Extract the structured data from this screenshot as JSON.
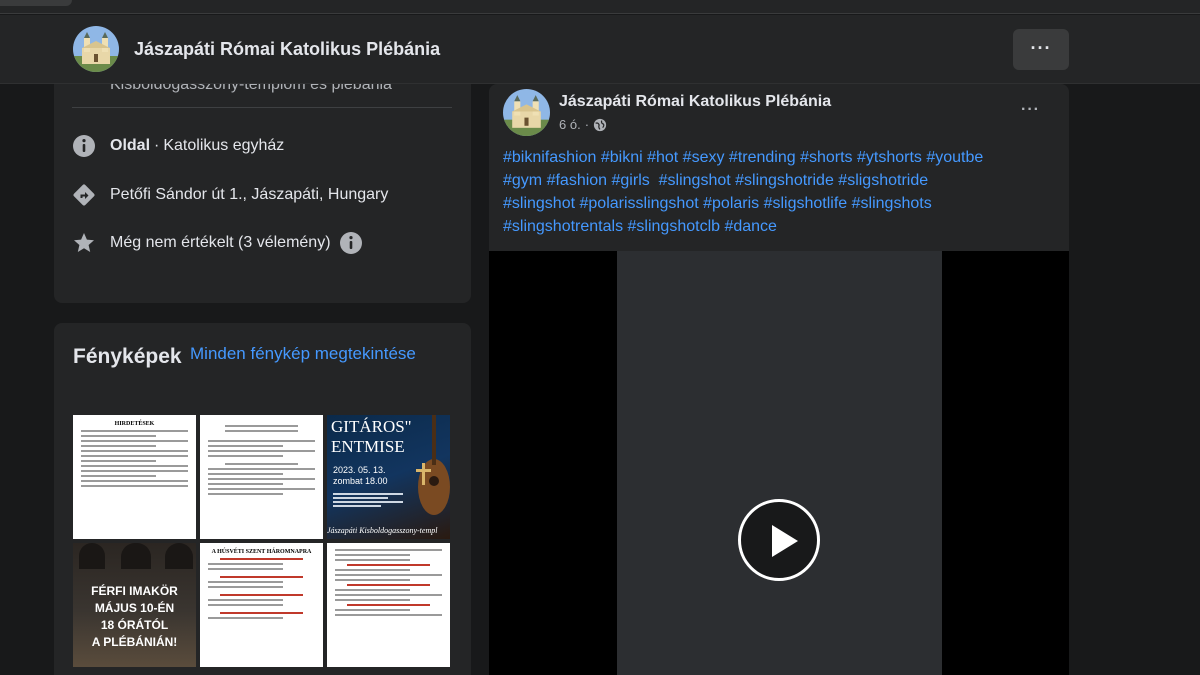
{
  "header": {
    "page_name": "Jászapáti Római Katolikus Plébánia",
    "more_label": "···"
  },
  "intro": {
    "partial_line": "Kisboldogasszony-templom és plébánia",
    "category_label": "Oldal",
    "category_sep": "·",
    "category_value": "Katolikus egyház",
    "address": "Petőfi Sándor út 1., Jászapáti, Hungary",
    "rating": "Még nem értékelt (3 vélemény)",
    "icons": [
      "info-icon",
      "directions-icon",
      "star-icon",
      "info-icon"
    ]
  },
  "photos": {
    "title": "Fényképek",
    "see_all": "Minden fénykép megtekintése",
    "thumbs": {
      "doc1_title": "HIRDETÉSEK",
      "concert_big_1": "GITÁROS\"",
      "concert_big_2": "ENTMISE",
      "concert_date_1": "2023. 05. 13.",
      "concert_date_2": "zombat 18.00",
      "concert_foot": "Jászapáti Kisboldogasszony-templ",
      "doc2_title": "A HÚSVÉTI SZENT HÁROMNAPRA",
      "prayer_line1": "FÉRFI IMAKÖR",
      "prayer_line2": "MÁJUS 10-ÉN",
      "prayer_line3": "18 ÓRÁTÓL",
      "prayer_line4": "A PLÉBÁNIÁN!"
    }
  },
  "post": {
    "author": "Jászapáti Római Katolikus Plébánia",
    "time": "6 ó.",
    "time_sep": "·",
    "more_label": "···",
    "text": "#biknifashion #bikni #hot #sexy #trending #shorts #ytshorts #youtbe\n#gym #fashion #girls  #slingshot #slingshotride #sligshotride\n#slingshot #polarisslingshot #polaris #sligshotlife #slingshots\n#slingshotrentals #slingshotclb #dance",
    "video": {
      "play_icon": "play-icon"
    }
  },
  "colors": {
    "background": "#18191a",
    "card": "#242526",
    "link": "#4599ff",
    "text": "#e4e6eb",
    "secondary_text": "#b0b3b8"
  }
}
